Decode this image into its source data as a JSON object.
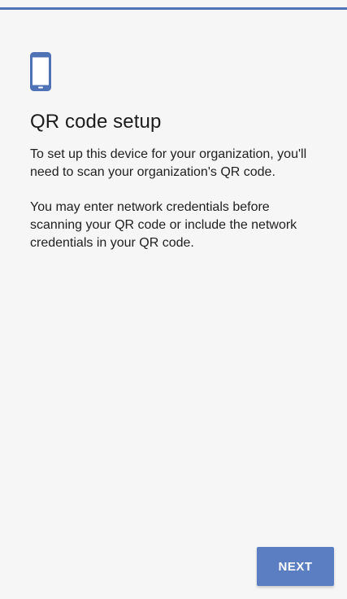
{
  "accent_color": "#4f71b6",
  "header": {
    "icon": "phone-device-icon"
  },
  "main": {
    "title": "QR code setup",
    "paragraphs": [
      "To set up this device for your organization, you'll need to scan your organization's QR code.",
      "You may enter network credentials before scanning your QR code or include the network credentials in your QR code."
    ]
  },
  "footer": {
    "next_label": "NEXT",
    "button_color": "#5b7ec2"
  }
}
